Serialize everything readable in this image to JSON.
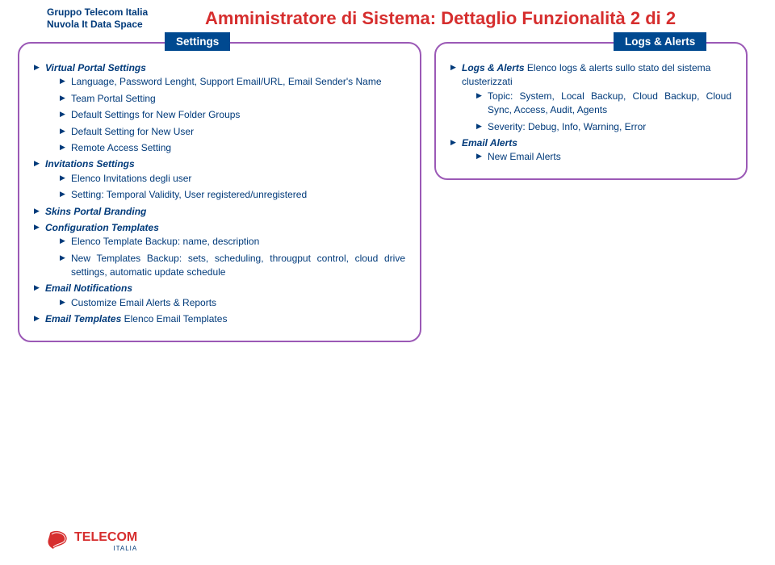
{
  "brand": {
    "line1": "Gruppo Telecom Italia",
    "line2": "Nuvola It Data Space"
  },
  "title": "Amministratore di Sistema: Dettaglio Funzionalità 2 di 2",
  "panels": {
    "settings": {
      "badge": "Settings",
      "items": [
        {
          "label": "Virtual Portal Settings",
          "bold": true,
          "children": [
            {
              "label": "Language, Password Lenght, Support Email/URL, Email Sender's Name"
            },
            {
              "label": "Team Portal Setting"
            },
            {
              "label": "Default Settings for New Folder Groups"
            },
            {
              "label": "Default Setting for New User"
            },
            {
              "label": "Remote Access Setting"
            }
          ]
        },
        {
          "label": "Invitations Settings",
          "bold": true,
          "children": [
            {
              "label": "Elenco Invitations degli user"
            },
            {
              "label": "Setting: Temporal Validity, User registered/unregistered"
            }
          ]
        },
        {
          "label": "Skins Portal Branding",
          "bold": true
        },
        {
          "label": "Configuration Templates",
          "bold": true,
          "children": [
            {
              "label": "Elenco Template Backup: name, description"
            },
            {
              "label": "New Templates Backup: sets, scheduling, througput control, cloud drive settings, automatic update schedule"
            }
          ]
        },
        {
          "label": "Email Notifications",
          "bold": true,
          "children": [
            {
              "label": "Customize Email Alerts & Reports"
            }
          ]
        },
        {
          "label_bold": "Email Templates",
          "label_rest": " Elenco Email Templates",
          "bold": true
        }
      ]
    },
    "logs": {
      "badge": "Logs & Alerts",
      "items": [
        {
          "label_bold": "Logs & Alerts",
          "label_rest": " Elenco logs & alerts sullo stato del sistema clusterizzati",
          "bold": true,
          "children": [
            {
              "label": "Topic: System, Local Backup, Cloud Backup, Cloud Sync, Access, Audit, Agents"
            },
            {
              "label": "Severity: Debug, Info, Warning, Error"
            }
          ]
        },
        {
          "label": "Email Alerts",
          "bold": true,
          "children": [
            {
              "label": "New Email Alerts"
            }
          ]
        }
      ]
    }
  },
  "footer": {
    "brand": "TELECOM",
    "sub": "ITALIA"
  }
}
